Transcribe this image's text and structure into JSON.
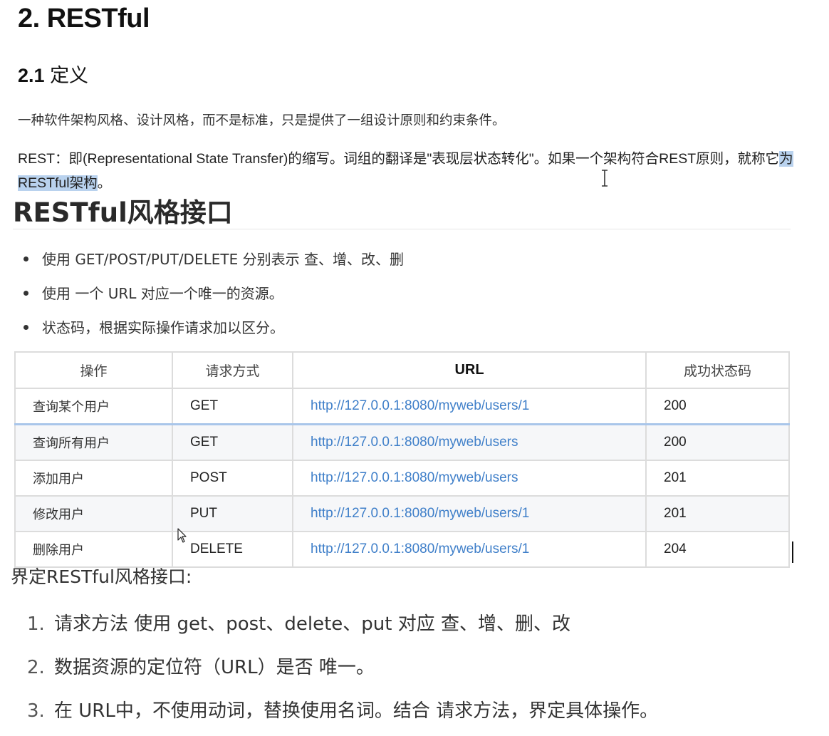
{
  "heading1": "2. RESTful",
  "heading2": {
    "number": "2.1",
    "text": "定义"
  },
  "para1": "一种软件架构风格、设计风格，而不是标准，只是提供了一组设计原则和约束条件。",
  "para2": {
    "before": "REST：即(Representational State Transfer)的缩写。词组的翻译是\"表现层状态转化\"。如果一个架构符合REST原则，就称它",
    "highlight": "为RESTful架构",
    "after": "。"
  },
  "section_title": "RESTful风格接口",
  "bullets": [
    "使用 GET/POST/PUT/DELETE 分别表示 查、增、改、删",
    "使用 一个 URL 对应一个唯一的资源。",
    "状态码，根据实际操作请求加以区分。"
  ],
  "table": {
    "headers": [
      "操作",
      "请求方式",
      "URL",
      "成功状态码"
    ],
    "rows": [
      [
        "查询某个用户",
        "GET",
        "http://127.0.0.1:8080/myweb/users/1",
        "200"
      ],
      [
        "查询所有用户",
        "GET",
        "http://127.0.0.1:8080/myweb/users",
        "200"
      ],
      [
        "添加用户",
        "POST",
        "http://127.0.0.1:8080/myweb/users",
        "201"
      ],
      [
        "修改用户",
        "PUT",
        "http://127.0.0.1:8080/myweb/users/1",
        "201"
      ],
      [
        "删除用户",
        "DELETE",
        "http://127.0.0.1:8080/myweb/users/1",
        "204"
      ]
    ]
  },
  "definition_title": "界定RESTful风格接口:",
  "rules": [
    {
      "index": "1.",
      "text": "请求方法 使用 get、post、delete、put 对应 查、增、删、改"
    },
    {
      "index": "2.",
      "text": "数据资源的定位符（URL）是否 唯一。"
    },
    {
      "index": "3.",
      "text": "在 URL中，不使用动词，替换使用名词。结合 请求方法，界定具体操作。"
    }
  ],
  "colors": {
    "link": "#3f7fc9",
    "selection": "#b9d2ee",
    "table_border": "#dcdcdc",
    "alt_row": "#f6f7f9"
  }
}
